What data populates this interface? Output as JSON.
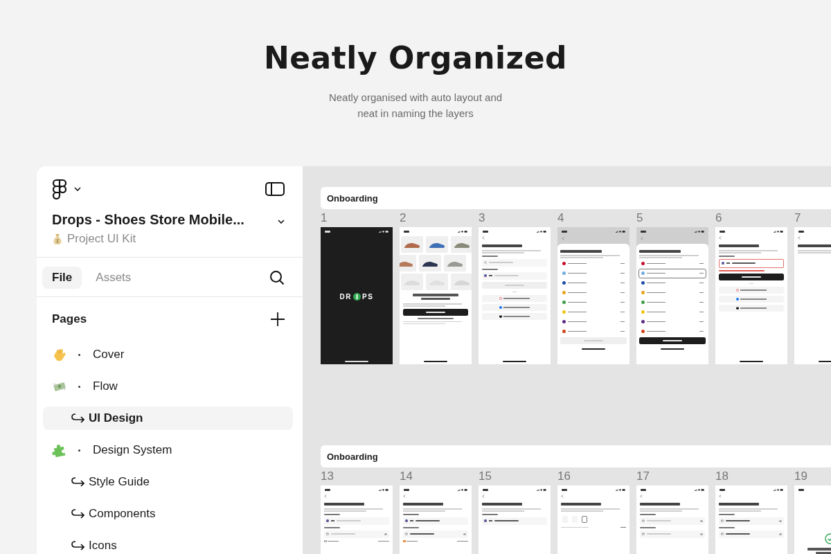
{
  "header": {
    "title": "Neatly Organized",
    "subtitle": "Neatly organised with auto layout and neat in naming the layers"
  },
  "sidebar": {
    "project": "Drops - Shoes Store Mobile...",
    "team": "Project UI Kit",
    "tabs": [
      {
        "label": "File",
        "selected": true
      },
      {
        "label": "Assets",
        "selected": false
      }
    ],
    "pages_title": "Pages",
    "pages": [
      {
        "label": "Cover",
        "selected": false
      },
      {
        "label": "Flow",
        "selected": false,
        "children": [
          {
            "label": "UI Design",
            "selected": true
          }
        ]
      },
      {
        "label": "Design System",
        "selected": false,
        "children": [
          {
            "label": "Style Guide",
            "selected": false
          },
          {
            "label": "Components",
            "selected": false
          },
          {
            "label": "Icons",
            "selected": false
          }
        ]
      }
    ]
  },
  "canvas": {
    "sections": [
      {
        "title": "Onboarding",
        "frames": [
          {
            "number": "1",
            "kind": "dark",
            "elements": [
              {
                "kind": "logo",
                "left": "DR",
                "right": "PS"
              }
            ]
          },
          {
            "number": "2",
            "kind": "light",
            "elements": [
              {
                "kind": "shoes"
              },
              {
                "kind": "title"
              },
              {
                "kind": "caption"
              },
              {
                "kind": "button",
                "disabled": false
              },
              {
                "kind": "link"
              },
              {
                "kind": "caption"
              }
            ]
          },
          {
            "number": "3",
            "kind": "light",
            "elements": [
              {
                "kind": "back"
              },
              {
                "kind": "heading"
              },
              {
                "kind": "caption"
              },
              {
                "kind": "label"
              },
              {
                "kind": "input",
                "prefix": false,
                "filled": false
              },
              {
                "kind": "label"
              },
              {
                "kind": "input",
                "prefix": true,
                "filled": false
              },
              {
                "kind": "button",
                "disabled": true
              },
              {
                "kind": "or"
              },
              {
                "kind": "social"
              },
              {
                "kind": "social"
              },
              {
                "kind": "social"
              }
            ]
          },
          {
            "number": "4",
            "kind": "sheet",
            "elements": [
              {
                "kind": "heading"
              },
              {
                "kind": "caption"
              },
              {
                "kind": "country",
                "color": "#c8102e",
                "selected": false
              },
              {
                "kind": "country",
                "color": "#74acdf",
                "selected": false
              },
              {
                "kind": "country",
                "color": "#1f4ea8",
                "selected": false
              },
              {
                "kind": "country",
                "color": "#e8a21b",
                "selected": false
              },
              {
                "kind": "country",
                "color": "#3f9c45",
                "selected": false
              },
              {
                "kind": "country",
                "color": "#f0c419",
                "selected": false
              },
              {
                "kind": "country",
                "color": "#5b2a86",
                "selected": false
              },
              {
                "kind": "country",
                "color": "#d4431a",
                "selected": false
              },
              {
                "kind": "button",
                "disabled": true
              }
            ]
          },
          {
            "number": "5",
            "kind": "sheet",
            "elements": [
              {
                "kind": "heading"
              },
              {
                "kind": "caption"
              },
              {
                "kind": "country",
                "color": "#c8102e",
                "selected": false
              },
              {
                "kind": "country",
                "color": "#74acdf",
                "selected": true
              },
              {
                "kind": "country",
                "color": "#1f4ea8",
                "selected": false
              },
              {
                "kind": "country",
                "color": "#e8a21b",
                "selected": false
              },
              {
                "kind": "country",
                "color": "#3f9c45",
                "selected": false
              },
              {
                "kind": "country",
                "color": "#f0c419",
                "selected": false
              },
              {
                "kind": "country",
                "color": "#5b2a86",
                "selected": false
              },
              {
                "kind": "country",
                "color": "#d4431a",
                "selected": false
              },
              {
                "kind": "button",
                "disabled": false
              }
            ]
          },
          {
            "number": "6",
            "kind": "light",
            "elements": [
              {
                "kind": "back"
              },
              {
                "kind": "heading"
              },
              {
                "kind": "caption"
              },
              {
                "kind": "label"
              },
              {
                "kind": "input",
                "prefix": true,
                "filled": true,
                "error": true
              },
              {
                "kind": "error"
              },
              {
                "kind": "button",
                "disabled": false
              },
              {
                "kind": "or"
              },
              {
                "kind": "social"
              },
              {
                "kind": "social"
              },
              {
                "kind": "social"
              }
            ]
          },
          {
            "number": "7",
            "kind": "light",
            "elements": [
              {
                "kind": "back"
              },
              {
                "kind": "heading"
              },
              {
                "kind": "caption"
              }
            ]
          }
        ]
      },
      {
        "title": "Onboarding",
        "frames": [
          {
            "number": "13",
            "kind": "light",
            "elements": [
              {
                "kind": "back"
              },
              {
                "kind": "heading"
              },
              {
                "kind": "caption"
              },
              {
                "kind": "label"
              },
              {
                "kind": "input",
                "prefix": true,
                "filled": false
              },
              {
                "kind": "label"
              },
              {
                "kind": "input",
                "secure": true,
                "filled": false
              },
              {
                "kind": "remember",
                "checked": false
              }
            ]
          },
          {
            "number": "14",
            "kind": "light",
            "elements": [
              {
                "kind": "back"
              },
              {
                "kind": "heading"
              },
              {
                "kind": "caption"
              },
              {
                "kind": "label"
              },
              {
                "kind": "input",
                "prefix": true,
                "filled": true
              },
              {
                "kind": "label"
              },
              {
                "kind": "input",
                "secure": true,
                "filled": true
              },
              {
                "kind": "remember",
                "checked": true
              }
            ]
          },
          {
            "number": "15",
            "kind": "light",
            "elements": [
              {
                "kind": "back"
              },
              {
                "kind": "heading"
              },
              {
                "kind": "caption"
              },
              {
                "kind": "label"
              },
              {
                "kind": "input",
                "prefix": true,
                "filled": true
              }
            ]
          },
          {
            "number": "16",
            "kind": "light",
            "elements": [
              {
                "kind": "back"
              },
              {
                "kind": "heading"
              },
              {
                "kind": "caption"
              },
              {
                "kind": "otp"
              },
              {
                "kind": "resend"
              }
            ]
          },
          {
            "number": "17",
            "kind": "light",
            "elements": [
              {
                "kind": "back"
              },
              {
                "kind": "heading"
              },
              {
                "kind": "caption"
              },
              {
                "kind": "label"
              },
              {
                "kind": "input",
                "secure": true,
                "filled": false
              },
              {
                "kind": "label"
              },
              {
                "kind": "input",
                "secure": true,
                "filled": false
              }
            ]
          },
          {
            "number": "18",
            "kind": "light",
            "elements": [
              {
                "kind": "back"
              },
              {
                "kind": "heading"
              },
              {
                "kind": "caption"
              },
              {
                "kind": "label"
              },
              {
                "kind": "input",
                "secure": true,
                "filled": true
              },
              {
                "kind": "label"
              },
              {
                "kind": "input",
                "secure": true,
                "filled": true
              }
            ]
          },
          {
            "number": "19",
            "kind": "light",
            "elements": [
              {
                "kind": "success"
              },
              {
                "kind": "title"
              }
            ]
          }
        ]
      }
    ]
  }
}
